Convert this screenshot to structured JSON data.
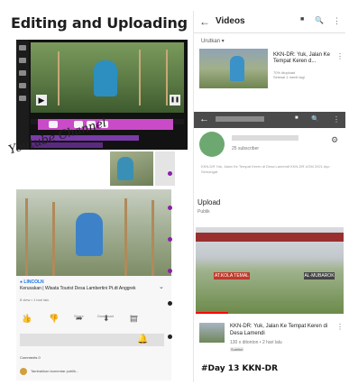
{
  "collage_title": "Editing and Uploading Process",
  "youtube_label": "Youtube Channel",
  "editor": {
    "controls": {
      "play": "▶",
      "pause": "❚❚"
    }
  },
  "left_card": {
    "channel": "● LINCOLN",
    "video_title": "Kerusakan | Wisata Tourist Desa Lambertini Pt.dt Anggrek",
    "views": "8 view • 1 hari lalu",
    "actions": [
      {
        "icon": "👍",
        "label": "0"
      },
      {
        "icon": "👎",
        "label": "0"
      },
      {
        "icon": "➦",
        "label": "Share"
      },
      {
        "icon": "⬇",
        "label": "Download"
      },
      {
        "icon": "▤",
        "label": "Save"
      }
    ],
    "bell": "🔔",
    "comments_header": "Comments 0",
    "comment_text": "Tambahkan komentar publik..."
  },
  "bullet_color": "#8b1fa8",
  "bullet_color_dark": "#222222",
  "right_app": {
    "header": {
      "back": "←",
      "title": "Videos",
      "cast": "■",
      "search": "🔍",
      "more": "⋮"
    },
    "sort_label": "Urutkan ▾",
    "video1": {
      "title": "KKN-DR: Yuk, Jalan Ke Tempat Keren d...",
      "meta": "70% diupload\nSelesai 1 menit lagi"
    },
    "detail_bar": {
      "back": "←",
      "cast": "■",
      "search": "🔍",
      "more": "⋮"
    },
    "subscribers": "25 subscriber",
    "description": "KKN-DR Yuk, Jalan Ke Tempat Keren di Desa Lamendi KKN-DR UGM 2021 Ayo Semangat",
    "upload_label": "Upload",
    "public_label": "Publik",
    "video2_banner": "AT.KOLA TEMAL",
    "video2_sign": "AL-MUBAROK",
    "video2_progress": 0.22,
    "video2": {
      "title": "KKN-DR: Yuk, Jalan Ke Tempat Keren di Desa Lamendi",
      "meta": "130 x ditonton • 2 hari lalu",
      "badge": "Subtitel"
    }
  },
  "bottom_caption": "#Day 13 KKN-DR"
}
